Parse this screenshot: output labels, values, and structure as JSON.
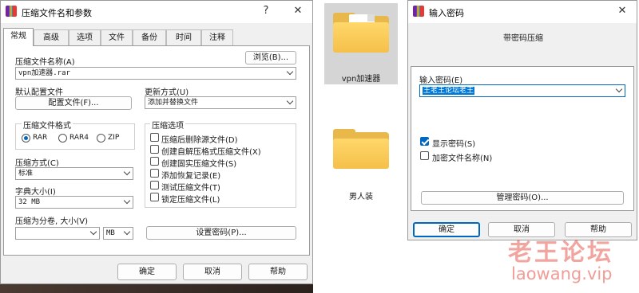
{
  "left_dialog": {
    "title": "压缩文件名和参数",
    "help_btn": "?",
    "close_btn": "✕",
    "tabs": [
      "常规",
      "高级",
      "选项",
      "文件",
      "备份",
      "时间",
      "注释"
    ],
    "archive_name_label": "压缩文件名称(A)",
    "browse_button": "浏览(B)...",
    "archive_name_value": "vpn加速器.rar",
    "default_profile_label": "默认配置文件",
    "profile_button": "配置文件(F)...",
    "update_mode_label": "更新方式(U)",
    "update_mode_value": "添加并替换文件",
    "format_label": "压缩文件格式",
    "formats": [
      "RAR",
      "RAR4",
      "ZIP"
    ],
    "selected_format": "RAR",
    "options_label": "压缩选项",
    "options": [
      {
        "label": "压缩后删除源文件(D)",
        "checked": false
      },
      {
        "label": "创建自解压格式压缩文件(X)",
        "checked": false
      },
      {
        "label": "创建固实压缩文件(S)",
        "checked": false
      },
      {
        "label": "添加恢复记录(E)",
        "checked": false
      },
      {
        "label": "测试压缩文件(T)",
        "checked": false
      },
      {
        "label": "锁定压缩文件(L)",
        "checked": false
      }
    ],
    "method_label": "压缩方式(C)",
    "method_value": "标准",
    "dict_label": "字典大小(I)",
    "dict_value": "32 MB",
    "split_label": "压缩为分卷, 大小(V)",
    "split_value": "",
    "split_unit": "MB",
    "set_password_button": "设置密码(P)...",
    "ok_button": "确定",
    "cancel_button": "取消",
    "help_button": "帮助"
  },
  "desktop": {
    "items": [
      {
        "label": "vpn加速器",
        "icon": "folder-with-document-icon",
        "selected": true
      },
      {
        "label": "男人装",
        "icon": "folder-icon",
        "selected": false
      }
    ]
  },
  "password_dialog": {
    "title": "输入密码",
    "close_btn": "✕",
    "heading": "带密码压缩",
    "password_label": "输入密码(E)",
    "password_value": "王老王论坛老王",
    "show_password_label": "显示密码(S)",
    "show_password_checked": true,
    "encrypt_names_label": "加密文件名称(N)",
    "encrypt_names_checked": false,
    "manage_button": "管理密码(O)...",
    "ok_button": "确定",
    "cancel_button": "取消",
    "help_button": "帮助"
  },
  "watermark": {
    "text": "老王论坛",
    "url": "laowang.vip"
  },
  "colors": {
    "accent": "#0067c0",
    "selection": "#0078d7",
    "folder": "#f5c04a",
    "watermark": "#e85a50"
  }
}
